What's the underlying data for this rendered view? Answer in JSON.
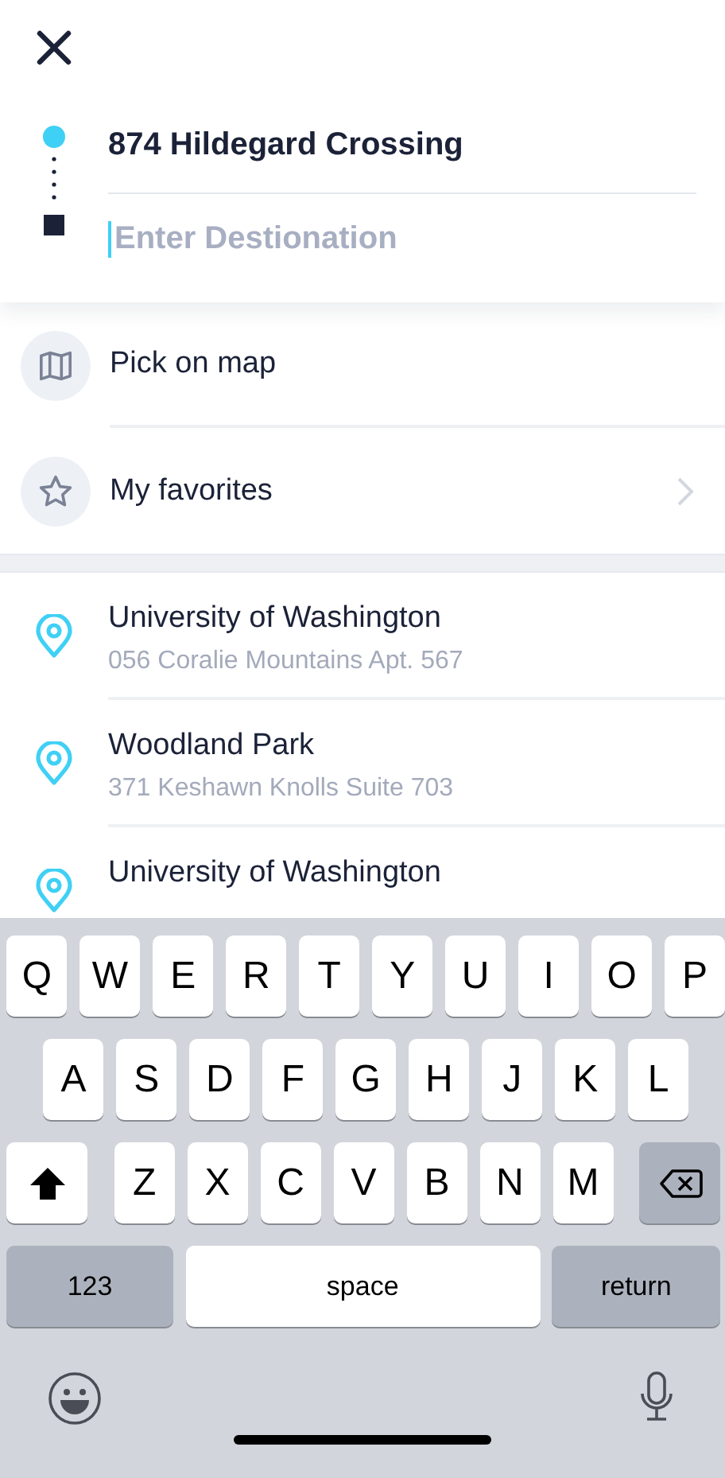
{
  "route": {
    "origin": "874 Hildegard Crossing",
    "destination_placeholder": "Enter Destionation"
  },
  "options": [
    {
      "kind": "map",
      "label": "Pick on map",
      "chevron": false
    },
    {
      "kind": "favorites",
      "label": "My favorites",
      "chevron": true
    }
  ],
  "recent": [
    {
      "title": "University of Washington",
      "address": "056 Coralie Mountains Apt. 567"
    },
    {
      "title": "Woodland Park",
      "address": "371 Keshawn Knolls Suite 703"
    },
    {
      "title": "University of Washington"
    }
  ],
  "keyboard": {
    "rows": [
      [
        "Q",
        "W",
        "E",
        "R",
        "T",
        "Y",
        "U",
        "I",
        "O",
        "P"
      ],
      [
        "A",
        "S",
        "D",
        "F",
        "G",
        "H",
        "J",
        "K",
        "L"
      ],
      [
        "Z",
        "X",
        "C",
        "V",
        "B",
        "N",
        "M"
      ]
    ],
    "numbers_key": "123",
    "space_key": "space",
    "return_key": "return"
  }
}
